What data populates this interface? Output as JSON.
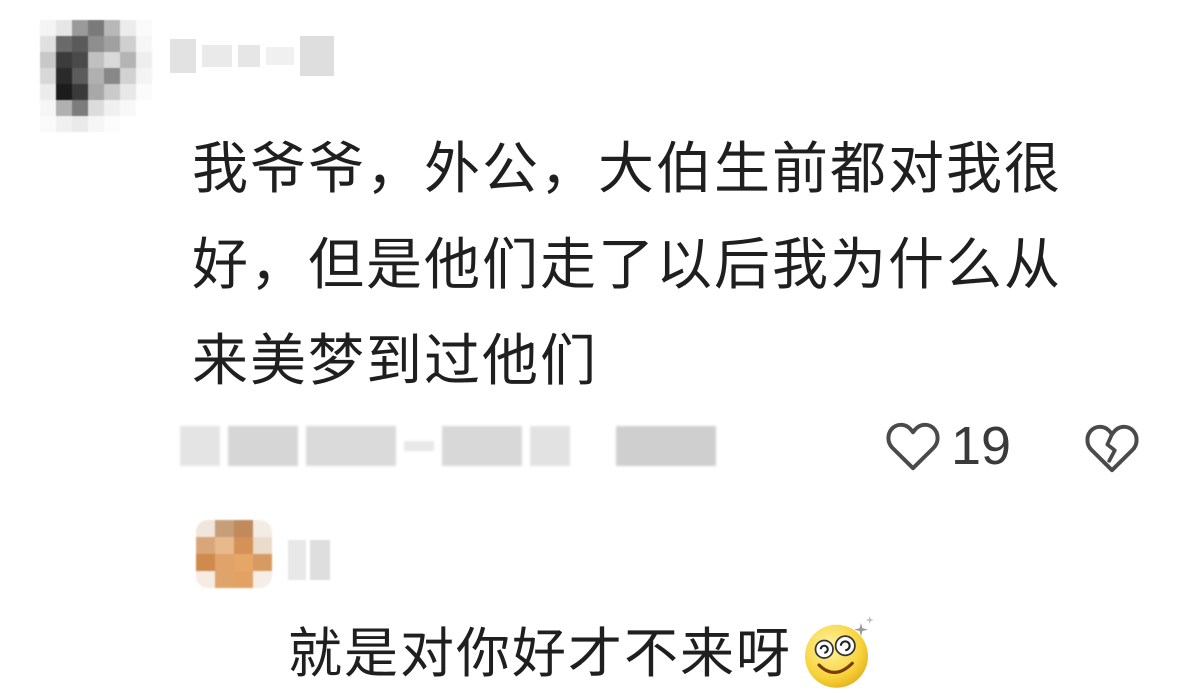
{
  "comment_1": {
    "text_line_1": "我爷爷，外公，大伯生前都对我很",
    "text_line_2": "好，但是他们走了以后我为什么从",
    "text_line_3": "来美梦到过他们",
    "like_count": "19",
    "like_icon": "heart-outline-icon",
    "dislike_icon": "broken-heart-icon"
  },
  "reply_1": {
    "text": "就是对你好才不来呀",
    "emoji": "dizzy-smile-emoji"
  }
}
